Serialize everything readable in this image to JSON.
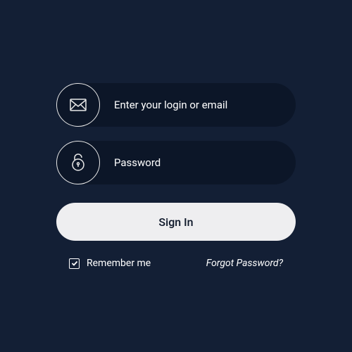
{
  "form": {
    "login_placeholder": "Enter your login or email",
    "password_placeholder": "Password",
    "signin_label": "Sign In",
    "remember_label": "Remember me",
    "remember_checked": true,
    "forgot_label": "Forgot Password?"
  },
  "colors": {
    "page_bg": "#131f35",
    "input_bg": "#0c1628",
    "button_bg": "#eeeef0",
    "text": "#ffffff"
  }
}
